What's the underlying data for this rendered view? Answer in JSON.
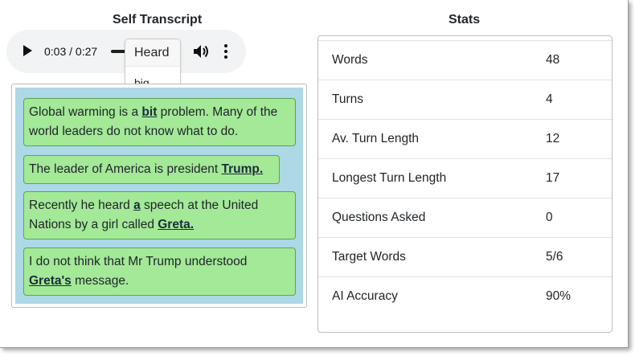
{
  "titles": {
    "left": "Self Transcript",
    "right": "Stats"
  },
  "audio": {
    "time": "0:03 / 0:27"
  },
  "popover": {
    "title": "Heard",
    "body": "big"
  },
  "transcript": [
    {
      "segments": [
        {
          "text": "Global warming is a ",
          "highlight": false
        },
        {
          "text": "bit",
          "highlight": true
        },
        {
          "text": " problem. Many of the world leaders do not know what to do.",
          "highlight": false
        }
      ]
    },
    {
      "segments": [
        {
          "text": "The leader of America is president ",
          "highlight": false
        },
        {
          "text": "Trump.",
          "highlight": true
        }
      ]
    },
    {
      "segments": [
        {
          "text": "Recently he heard ",
          "highlight": false
        },
        {
          "text": "a",
          "highlight": true
        },
        {
          "text": " speech at the United Nations by a girl called ",
          "highlight": false
        },
        {
          "text": "Greta.",
          "highlight": true
        }
      ]
    },
    {
      "segments": [
        {
          "text": "I do not think that Mr Trump understood ",
          "highlight": false
        },
        {
          "text": "Greta's",
          "highlight": true
        },
        {
          "text": " message.",
          "highlight": false
        }
      ]
    }
  ],
  "stats": [
    {
      "label": "Words",
      "value": "48"
    },
    {
      "label": "Turns",
      "value": "4"
    },
    {
      "label": "Av. Turn Length",
      "value": "12"
    },
    {
      "label": "Longest Turn Length",
      "value": "17"
    },
    {
      "label": "Questions Asked",
      "value": "0"
    },
    {
      "label": "Target Words",
      "value": "5/6"
    },
    {
      "label": "AI Accuracy",
      "value": "90%"
    }
  ],
  "colors": {
    "bubble": "#a3e998",
    "transcript_bg": "#add8e6",
    "player_bg": "#f1f3f4"
  },
  "icons": [
    "play-icon",
    "volume-icon",
    "more-options-icon"
  ]
}
